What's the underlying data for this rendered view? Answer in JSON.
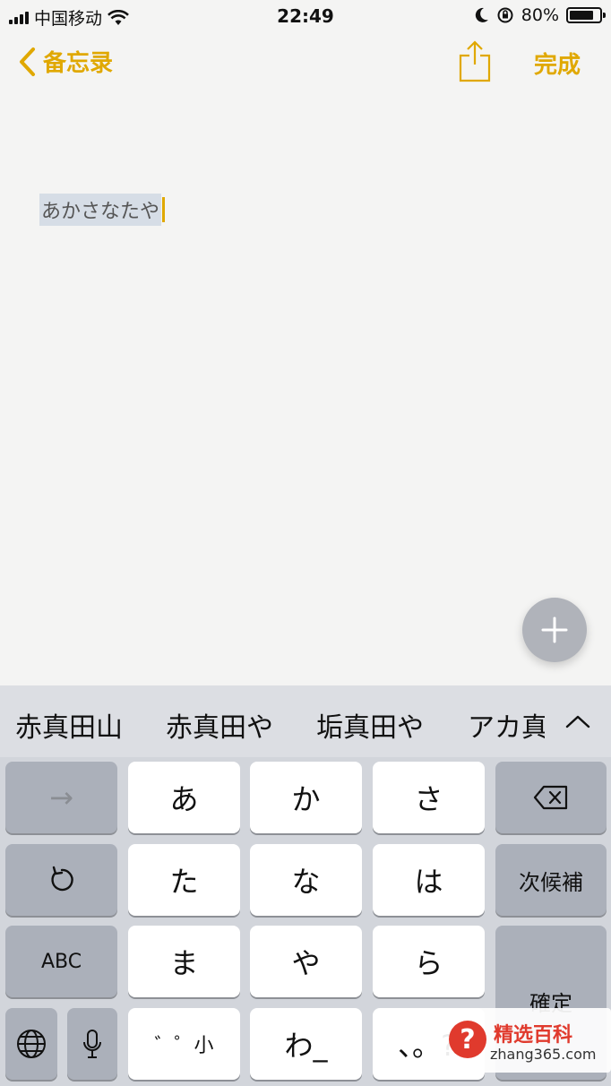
{
  "status_bar": {
    "carrier": "中国移动",
    "time": "22:49",
    "battery_percent": "80%",
    "battery_level": 0.8,
    "icons": [
      "signal-icon",
      "wifi-icon",
      "moon-icon",
      "orientation-lock-icon",
      "battery-icon"
    ]
  },
  "nav": {
    "back_label": "备忘录",
    "done_label": "完成",
    "accent": "#e0a800"
  },
  "note": {
    "marked_text": "あかさなたや"
  },
  "keyboard": {
    "candidates": [
      "赤真田山",
      "赤真田や",
      "垢真田や",
      "アカ真"
    ],
    "rows": {
      "r1": [
        "→",
        "あ",
        "か",
        "さ",
        "backspace"
      ],
      "r2": [
        "undo",
        "た",
        "な",
        "は",
        "次候補"
      ],
      "r3": [
        "ABC",
        "ま",
        "や",
        "ら",
        "確定"
      ],
      "r4": [
        "globe",
        "mic",
        "゛゜小",
        "わ_",
        "、。?!"
      ]
    },
    "labels": {
      "arrow": "→",
      "a": "あ",
      "ka": "か",
      "sa": "さ",
      "ta": "た",
      "na": "な",
      "ha": "は",
      "next_candidate": "次候補",
      "abc": "ABC",
      "ma": "ま",
      "ya": "や",
      "ra": "ら",
      "confirm": "確定",
      "dakuten": "゛゜小",
      "wa": "わ_",
      "punct": "、。?!"
    }
  },
  "watermark": {
    "title": "精选百科",
    "url": "zhang365.com"
  }
}
